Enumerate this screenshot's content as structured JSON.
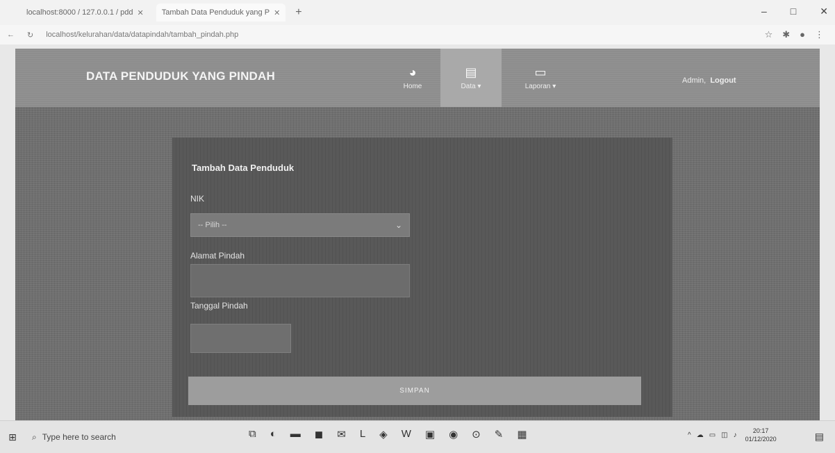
{
  "browser": {
    "tabs": [
      {
        "title": "localhost:8000 / 127.0.0.1 / pdd",
        "active": false
      },
      {
        "title": "Tambah Data Penduduk yang P",
        "active": true
      }
    ],
    "address": "localhost/kelurahan/data/datapindah/tambah_pindah.php",
    "controls": {
      "minimize": "–",
      "maximize": "□",
      "close": "✕"
    }
  },
  "app": {
    "brand": "DATA PENDUDUK YANG PINDAH",
    "nav": {
      "home": {
        "label": "Home",
        "icon": "dashboard-icon"
      },
      "data": {
        "label": "Data ▾",
        "icon": "file-icon"
      },
      "laporan": {
        "label": "Laporan ▾",
        "icon": "laptop-icon"
      }
    },
    "user": {
      "name": "Admin,",
      "logout": "Logout"
    }
  },
  "form": {
    "title": "Tambah Data Penduduk",
    "nik_label": "NIK",
    "nik_selected": "-- Pilih --",
    "alamat_label": "Alamat Pindah",
    "alamat_value": "",
    "tanggal_label": "Tanggal Pindah",
    "tanggal_value": "",
    "submit_label": "SIMPAN"
  },
  "taskbar": {
    "search_placeholder": "Type here to search",
    "apps": [
      "task-view-icon",
      "edge-icon",
      "file-explorer-icon",
      "store-icon",
      "mail-icon",
      "l-app-icon",
      "shield-app-icon",
      "word-icon",
      "image-app-icon",
      "chrome-icon",
      "media-icon",
      "paint-icon",
      "photos-icon"
    ],
    "time": "20:17",
    "date": "01/12/2020"
  }
}
